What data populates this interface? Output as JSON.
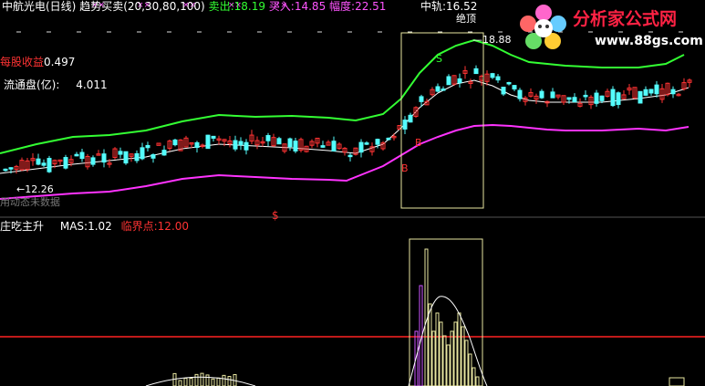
{
  "header": {
    "stock_name": "中航光电(日线)",
    "indicator_name": "趋势买卖(20,30,80,100)",
    "sell_label": "卖出:",
    "sell_value": "18.19",
    "buy_label": "买入:",
    "buy_value": "14.85",
    "range_label": "幅度:",
    "range_value": "22.51",
    "mid_label": "中轨:",
    "mid_value": "16.52"
  },
  "top_panel": {
    "eps_label": "每股收益",
    "eps_value": "0.497",
    "float_label": "流通盘(亿):",
    "float_value": "4.011",
    "top_tag": "绝顶",
    "high_price": "18.88",
    "low_price": "12.26",
    "bottom_left_text": "用动态未数据",
    "sell_marker": "$",
    "b_marker": "B",
    "s_marker": "S"
  },
  "bottom_panel": {
    "indicator_name": "庄吃主升",
    "mas_label": "MAS:",
    "mas_value": "1.02",
    "critical_label": "临界点:",
    "critical_value": "12.00"
  },
  "logo": {
    "text": "分析家公式网",
    "url": "www.88gs.com"
  },
  "colors": {
    "background": "#000000",
    "up_candle": "#ff3333",
    "down_candle": "#54fcfc",
    "upper_band": "#33ff33",
    "lower_band": "#ff33ff",
    "middle_band": "#ffffff",
    "critical_line": "#ff2222",
    "highlight_box": "#e8e6a0",
    "header_white": "#ffffff",
    "header_green": "#33ff33",
    "header_magenta": "#ff55ff",
    "header_red": "#ff3333"
  },
  "chart_data": {
    "type": "line",
    "title": "中航光电(日线)",
    "series": [
      {
        "name": "卖出",
        "values": [
          18.19
        ]
      },
      {
        "name": "买入",
        "values": [
          14.85
        ]
      },
      {
        "name": "中轨",
        "values": [
          16.52
        ]
      }
    ],
    "critical_level": 12.0,
    "mas": 1.02,
    "period_high": 18.88,
    "period_low": 12.26
  }
}
